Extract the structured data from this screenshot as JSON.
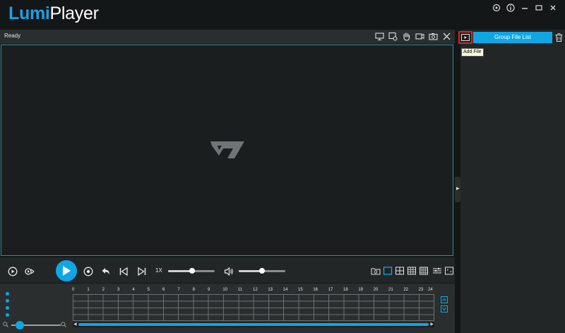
{
  "app": {
    "name_part1": "Lumi",
    "name_part2": "Player"
  },
  "window_controls": [
    "settings-icon",
    "info-icon",
    "minimize-icon",
    "maximize-icon",
    "close-icon"
  ],
  "video": {
    "status": "Ready"
  },
  "video_toolbar": [
    "monitor-icon",
    "window-settings-icon",
    "hand-icon",
    "record-icon",
    "camera-icon",
    "close-icon"
  ],
  "right_panel": {
    "add_file_tooltip": "Add File",
    "tab_label": "Group File List"
  },
  "playback": {
    "speed_label": "1X",
    "progress_value": 0.52,
    "volume_value": 0.5
  },
  "timeline": {
    "hours": [
      "0",
      "1",
      "2",
      "3",
      "4",
      "5",
      "6",
      "7",
      "8",
      "9",
      "10",
      "11",
      "12",
      "13",
      "14",
      "15",
      "16",
      "17",
      "18",
      "19",
      "20",
      "21",
      "22",
      "23",
      "24"
    ],
    "zoom_value": 0.1
  },
  "colors": {
    "accent": "#10a6e4",
    "highlight": "#e02020",
    "background": "#141717"
  }
}
